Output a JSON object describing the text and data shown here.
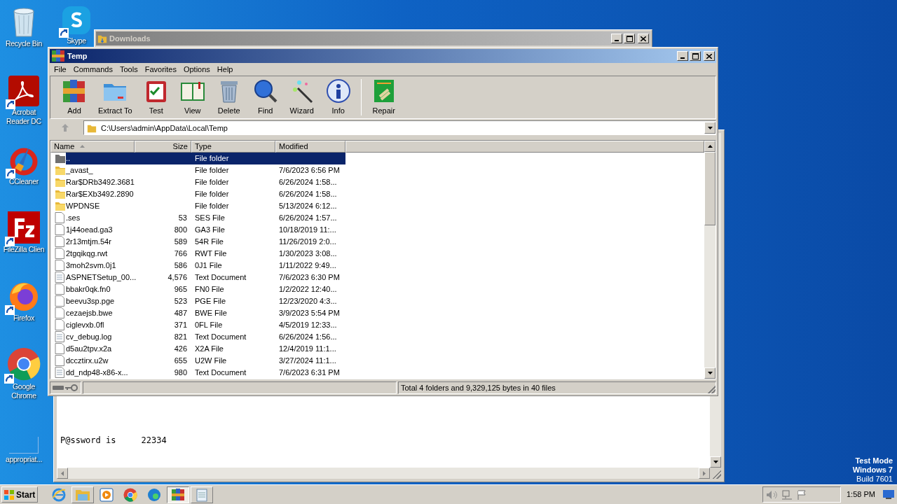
{
  "desktop_icons": [
    {
      "label": "Recycle Bin",
      "kind": "recycle",
      "shortcut": false
    },
    {
      "label": "Skype",
      "kind": "skype",
      "shortcut": true
    },
    {
      "label": "Acrobat Reader DC",
      "kind": "acrobat",
      "shortcut": true
    },
    {
      "label": "CCleaner",
      "kind": "ccleaner",
      "shortcut": true
    },
    {
      "label": "FileZilla Clien",
      "kind": "filezilla",
      "shortcut": true
    },
    {
      "label": "Firefox",
      "kind": "firefox",
      "shortcut": true
    },
    {
      "label": "Google Chrome",
      "kind": "chrome",
      "shortcut": true
    },
    {
      "label": "appropriat...",
      "kind": "blank",
      "shortcut": false
    }
  ],
  "background_windows": [
    {
      "title": "Downloads"
    }
  ],
  "notepad": {
    "lines": [
      "P@ssword is     22334"
    ]
  },
  "window": {
    "title": "Temp",
    "menu": [
      "File",
      "Commands",
      "Tools",
      "Favorites",
      "Options",
      "Help"
    ],
    "toolbar": [
      {
        "label": "Add",
        "kind": "add"
      },
      {
        "label": "Extract To",
        "kind": "extract"
      },
      {
        "label": "Test",
        "kind": "test"
      },
      {
        "label": "View",
        "kind": "view"
      },
      {
        "label": "Delete",
        "kind": "delete"
      },
      {
        "label": "Find",
        "kind": "find"
      },
      {
        "label": "Wizard",
        "kind": "wizard"
      },
      {
        "label": "Info",
        "kind": "info"
      },
      {
        "label": "Repair",
        "kind": "repair"
      }
    ],
    "address": "C:\\Users\\admin\\AppData\\Local\\Temp",
    "table": {
      "columns": [
        "Name",
        "Size",
        "Type",
        "Modified"
      ],
      "rows": [
        {
          "name": "..",
          "size": "",
          "type": "File folder",
          "modified": "",
          "kind": "parent",
          "selected": true
        },
        {
          "name": "_avast_",
          "size": "",
          "type": "File folder",
          "modified": "7/6/2023 6:56 PM",
          "kind": "folder",
          "selected": false
        },
        {
          "name": "Rar$DRb3492.3681",
          "size": "",
          "type": "File folder",
          "modified": "6/26/2024 1:58...",
          "kind": "folder",
          "selected": false
        },
        {
          "name": "Rar$EXb3492.2890",
          "size": "",
          "type": "File folder",
          "modified": "6/26/2024 1:58...",
          "kind": "folder",
          "selected": false
        },
        {
          "name": "WPDNSE",
          "size": "",
          "type": "File folder",
          "modified": "5/13/2024 6:12...",
          "kind": "folder",
          "selected": false
        },
        {
          "name": ".ses",
          "size": "53",
          "type": "SES File",
          "modified": "6/26/2024 1:57...",
          "kind": "file",
          "selected": false
        },
        {
          "name": "1j44oead.ga3",
          "size": "800",
          "type": "GA3 File",
          "modified": "10/18/2019 11:...",
          "kind": "file",
          "selected": false
        },
        {
          "name": "2r13mtjm.54r",
          "size": "589",
          "type": "54R File",
          "modified": "11/26/2019 2:0...",
          "kind": "file",
          "selected": false
        },
        {
          "name": "2tgqikqg.rwt",
          "size": "766",
          "type": "RWT File",
          "modified": "1/30/2023 3:08...",
          "kind": "file",
          "selected": false
        },
        {
          "name": "3moh2svm.0j1",
          "size": "586",
          "type": "0J1 File",
          "modified": "1/11/2022 9:49...",
          "kind": "file",
          "selected": false
        },
        {
          "name": "ASPNETSetup_00...",
          "size": "4,576",
          "type": "Text Document",
          "modified": "7/6/2023 6:30 PM",
          "kind": "text",
          "selected": false
        },
        {
          "name": "bbakr0qk.fn0",
          "size": "965",
          "type": "FN0 File",
          "modified": "1/2/2022 12:40...",
          "kind": "file",
          "selected": false
        },
        {
          "name": "beevu3sp.pge",
          "size": "523",
          "type": "PGE File",
          "modified": "12/23/2020 4:3...",
          "kind": "file",
          "selected": false
        },
        {
          "name": "cezaejsb.bwe",
          "size": "487",
          "type": "BWE File",
          "modified": "3/9/2023 5:54 PM",
          "kind": "file",
          "selected": false
        },
        {
          "name": "ciglevxb.0fl",
          "size": "371",
          "type": "0FL File",
          "modified": "4/5/2019 12:33...",
          "kind": "file",
          "selected": false
        },
        {
          "name": "cv_debug.log",
          "size": "821",
          "type": "Text Document",
          "modified": "6/26/2024 1:56...",
          "kind": "text",
          "selected": false
        },
        {
          "name": "d5au2tpv.x2a",
          "size": "426",
          "type": "X2A File",
          "modified": "12/4/2019 11:1...",
          "kind": "file",
          "selected": false
        },
        {
          "name": "dccztirx.u2w",
          "size": "655",
          "type": "U2W File",
          "modified": "3/27/2024 11:1...",
          "kind": "file",
          "selected": false
        },
        {
          "name": "dd_ndp48-x86-x...",
          "size": "980",
          "type": "Text Document",
          "modified": "7/6/2023 6:31 PM",
          "kind": "text",
          "selected": false
        }
      ]
    },
    "status_bar": "Total 4 folders and 9,329,125 bytes in 40 files"
  },
  "watermark_text": [
    "Test Mode",
    "Windows 7",
    "Build 7601"
  ],
  "taskbar": {
    "start": "Start",
    "items": [
      {
        "kind": "ie",
        "open": false,
        "selected": false
      },
      {
        "kind": "explorer",
        "open": true,
        "selected": false
      },
      {
        "kind": "media",
        "open": false,
        "selected": false
      },
      {
        "kind": "chrome",
        "open": false,
        "selected": false
      },
      {
        "kind": "edge",
        "open": false,
        "selected": false
      },
      {
        "kind": "winrar",
        "open": true,
        "selected": true
      },
      {
        "kind": "notepad",
        "open": true,
        "selected": false
      }
    ],
    "clock": "1:58 PM"
  }
}
